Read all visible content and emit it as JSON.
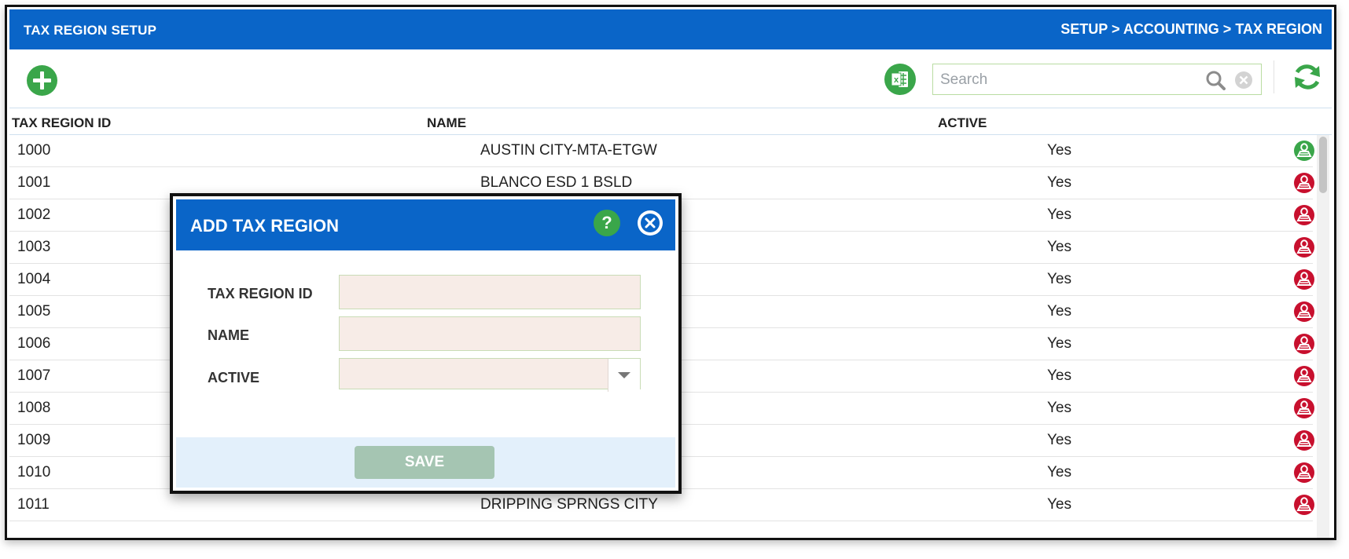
{
  "header": {
    "title": "TAX REGION SETUP",
    "breadcrumb": "SETUP > ACCOUNTING > TAX REGION"
  },
  "toolbar": {
    "search_placeholder": "Search",
    "excel_icon_text": "x"
  },
  "colors": {
    "header_blue": "#0a65c8",
    "action_green": "#3aa64a",
    "action_red": "#c8102e",
    "field_bg": "#f7ece7"
  },
  "table": {
    "columns": [
      "TAX REGION ID",
      "NAME",
      "ACTIVE"
    ],
    "rows": [
      {
        "id": "1000",
        "name": "AUSTIN CITY-MTA-ETGW",
        "active": "Yes",
        "status": "green"
      },
      {
        "id": "1001",
        "name": "BLANCO ESD 1 BSLD",
        "active": "Yes",
        "status": "red"
      },
      {
        "id": "1002",
        "name": "",
        "active": "Yes",
        "status": "red"
      },
      {
        "id": "1003",
        "name": "",
        "active": "Yes",
        "status": "red"
      },
      {
        "id": "1004",
        "name": "",
        "active": "Yes",
        "status": "red"
      },
      {
        "id": "1005",
        "name": "",
        "active": "Yes",
        "status": "red"
      },
      {
        "id": "1006",
        "name": "",
        "active": "Yes",
        "status": "red"
      },
      {
        "id": "1007",
        "name": "",
        "active": "Yes",
        "status": "red"
      },
      {
        "id": "1008",
        "name": "",
        "active": "Yes",
        "status": "red"
      },
      {
        "id": "1009",
        "name": "",
        "active": "Yes",
        "status": "red"
      },
      {
        "id": "1010",
        "name": "",
        "active": "Yes",
        "status": "red"
      },
      {
        "id": "1011",
        "name": "DRIPPING SPRNGS CITY",
        "active": "Yes",
        "status": "red"
      }
    ]
  },
  "modal": {
    "title": "ADD TAX REGION",
    "help_label": "?",
    "fields": [
      {
        "label": "TAX REGION ID",
        "value": ""
      },
      {
        "label": "NAME",
        "value": ""
      },
      {
        "label": "ACTIVE",
        "value": ""
      }
    ],
    "save_label": "SAVE"
  }
}
